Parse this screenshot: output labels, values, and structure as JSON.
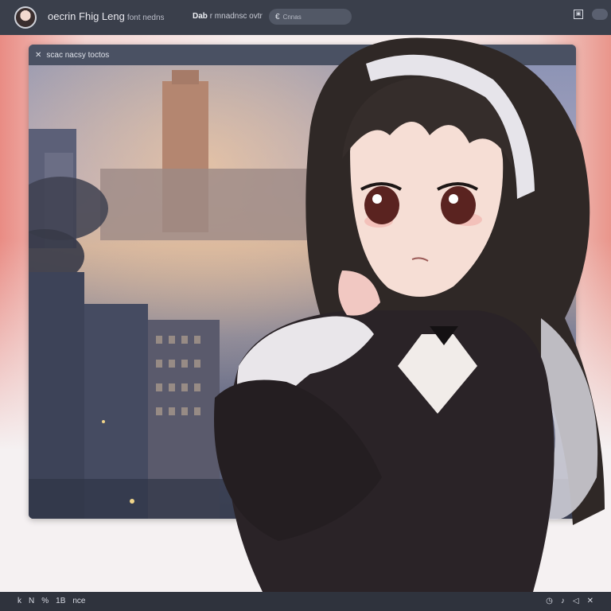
{
  "topbar": {
    "app_title": "oecrin Fhig Leng",
    "app_subtitle": "font nedns",
    "nav_label_bold": "Dab",
    "nav_label_rest": "r mnadnsc ovtr",
    "search_placeholder": "Cnnas",
    "search_icon": "€"
  },
  "window": {
    "title": "scac nacsy toctos",
    "close_glyph": "✕"
  },
  "bottombar": {
    "left_items": [
      "k",
      "N",
      "%",
      "1B",
      "nce"
    ],
    "right_items": [
      "◷",
      "♪",
      "◁",
      "✕"
    ]
  },
  "colors": {
    "topbar": "#3a3f4b",
    "accent_coral": "#e98c84",
    "bottombar": "#2f333d"
  }
}
